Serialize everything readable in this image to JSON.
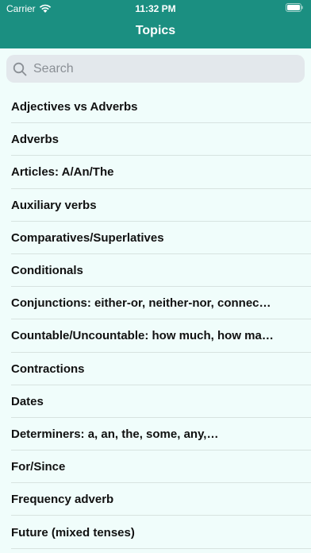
{
  "status_bar": {
    "carrier": "Carrier",
    "time": "11:32 PM",
    "icons": [
      "wifi-icon",
      "battery-icon"
    ]
  },
  "nav": {
    "title": "Topics"
  },
  "search": {
    "placeholder": "Search",
    "value": "",
    "icon": "search-icon"
  },
  "topics": [
    {
      "label": "Adjectives vs Adverbs"
    },
    {
      "label": "Adverbs"
    },
    {
      "label": "Articles: A/An/The"
    },
    {
      "label": "Auxiliary verbs"
    },
    {
      "label": "Comparatives/Superlatives"
    },
    {
      "label": "Conditionals"
    },
    {
      "label": "Conjunctions: either-or, neither-nor, connec…"
    },
    {
      "label": "Countable/Uncountable: how much, how ma…"
    },
    {
      "label": "Contractions"
    },
    {
      "label": "Dates"
    },
    {
      "label": "Determiners: a, an, the, some, any,…"
    },
    {
      "label": "For/Since"
    },
    {
      "label": "Frequency adverb"
    },
    {
      "label": "Future (mixed tenses)"
    }
  ],
  "colors": {
    "header": "#1b8f81",
    "background": "#f0fdfb",
    "search_field": "#e3e8ec"
  }
}
